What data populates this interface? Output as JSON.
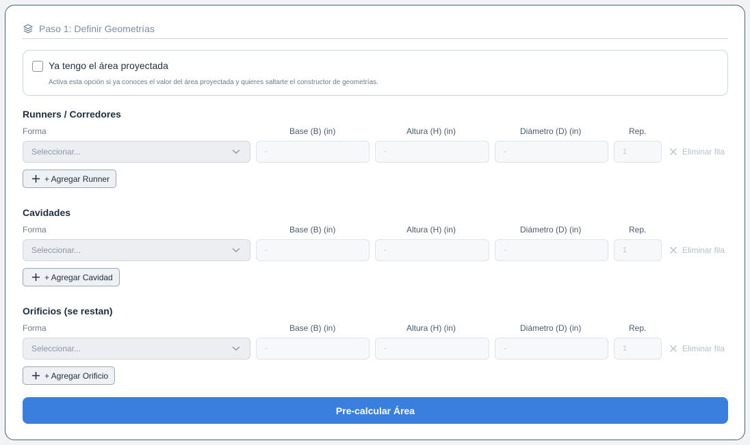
{
  "header": {
    "title": "Paso 1: Definir Geometrías",
    "icon": "layers-icon"
  },
  "projected_area": {
    "checked": false,
    "label": "Ya tengo el área proyectada",
    "description": "Activa esta opción si ya conoces el valor del área proyectada y quieres saltarte el constructor de geometrías."
  },
  "columns": {
    "forma": "Forma",
    "base": "Base (B) (in)",
    "altura": "Altura (H) (in)",
    "diametro": "Diámetro (D) (in)",
    "rep": "Rep."
  },
  "sections": [
    {
      "title": "Runners / Corredores",
      "select_placeholder": "Seleccionar...",
      "base": "-",
      "altura": "-",
      "diametro": "-",
      "rep": "1",
      "delete_label": "Eliminar fila",
      "add_label": "+ Agregar Runner"
    },
    {
      "title": "Cavidades",
      "select_placeholder": "Seleccionar...",
      "base": "-",
      "altura": "-",
      "diametro": "-",
      "rep": "1",
      "delete_label": "Eliminar fila",
      "add_label": "+ Agregar Cavidad"
    },
    {
      "title": "Orificios (se restan)",
      "select_placeholder": "Seleccionar...",
      "base": "-",
      "altura": "-",
      "diametro": "-",
      "rep": "1",
      "delete_label": "Eliminar fila",
      "add_label": "+ Agregar Orificio"
    }
  ],
  "primary_button": "Pre-calcular Área",
  "colors": {
    "primary": "#3a7fdd",
    "border": "#4a5d78",
    "muted_text": "#8a96a6"
  }
}
